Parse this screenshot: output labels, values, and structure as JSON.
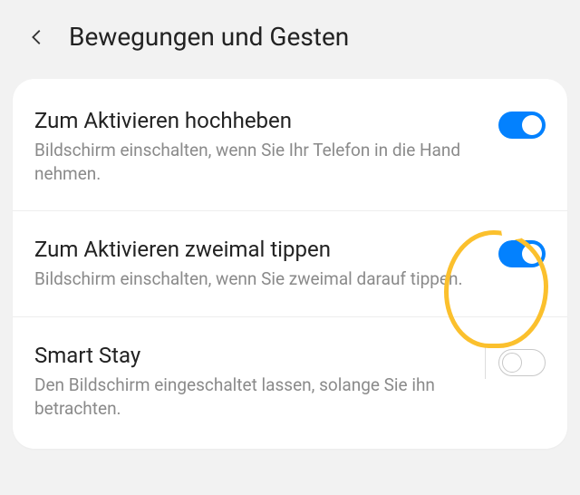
{
  "header": {
    "title": "Bewegungen und Gesten"
  },
  "settings": [
    {
      "title": "Zum Aktivieren hochheben",
      "desc": "Bildschirm einschalten, wenn Sie Ihr Telefon in die Hand nehmen.",
      "enabled": true,
      "has_divider": false
    },
    {
      "title": "Zum Aktivieren zweimal tippen",
      "desc": "Bildschirm einschalten, wenn Sie zweimal darauf tippen.",
      "enabled": true,
      "has_divider": false
    },
    {
      "title": "Smart Stay",
      "desc": "Den Bildschirm eingeschaltet lassen, solange Sie ihn betrachten.",
      "enabled": false,
      "has_divider": true
    }
  ],
  "annotation": {
    "highlighted_index": 1,
    "color": "#fbc02d"
  }
}
